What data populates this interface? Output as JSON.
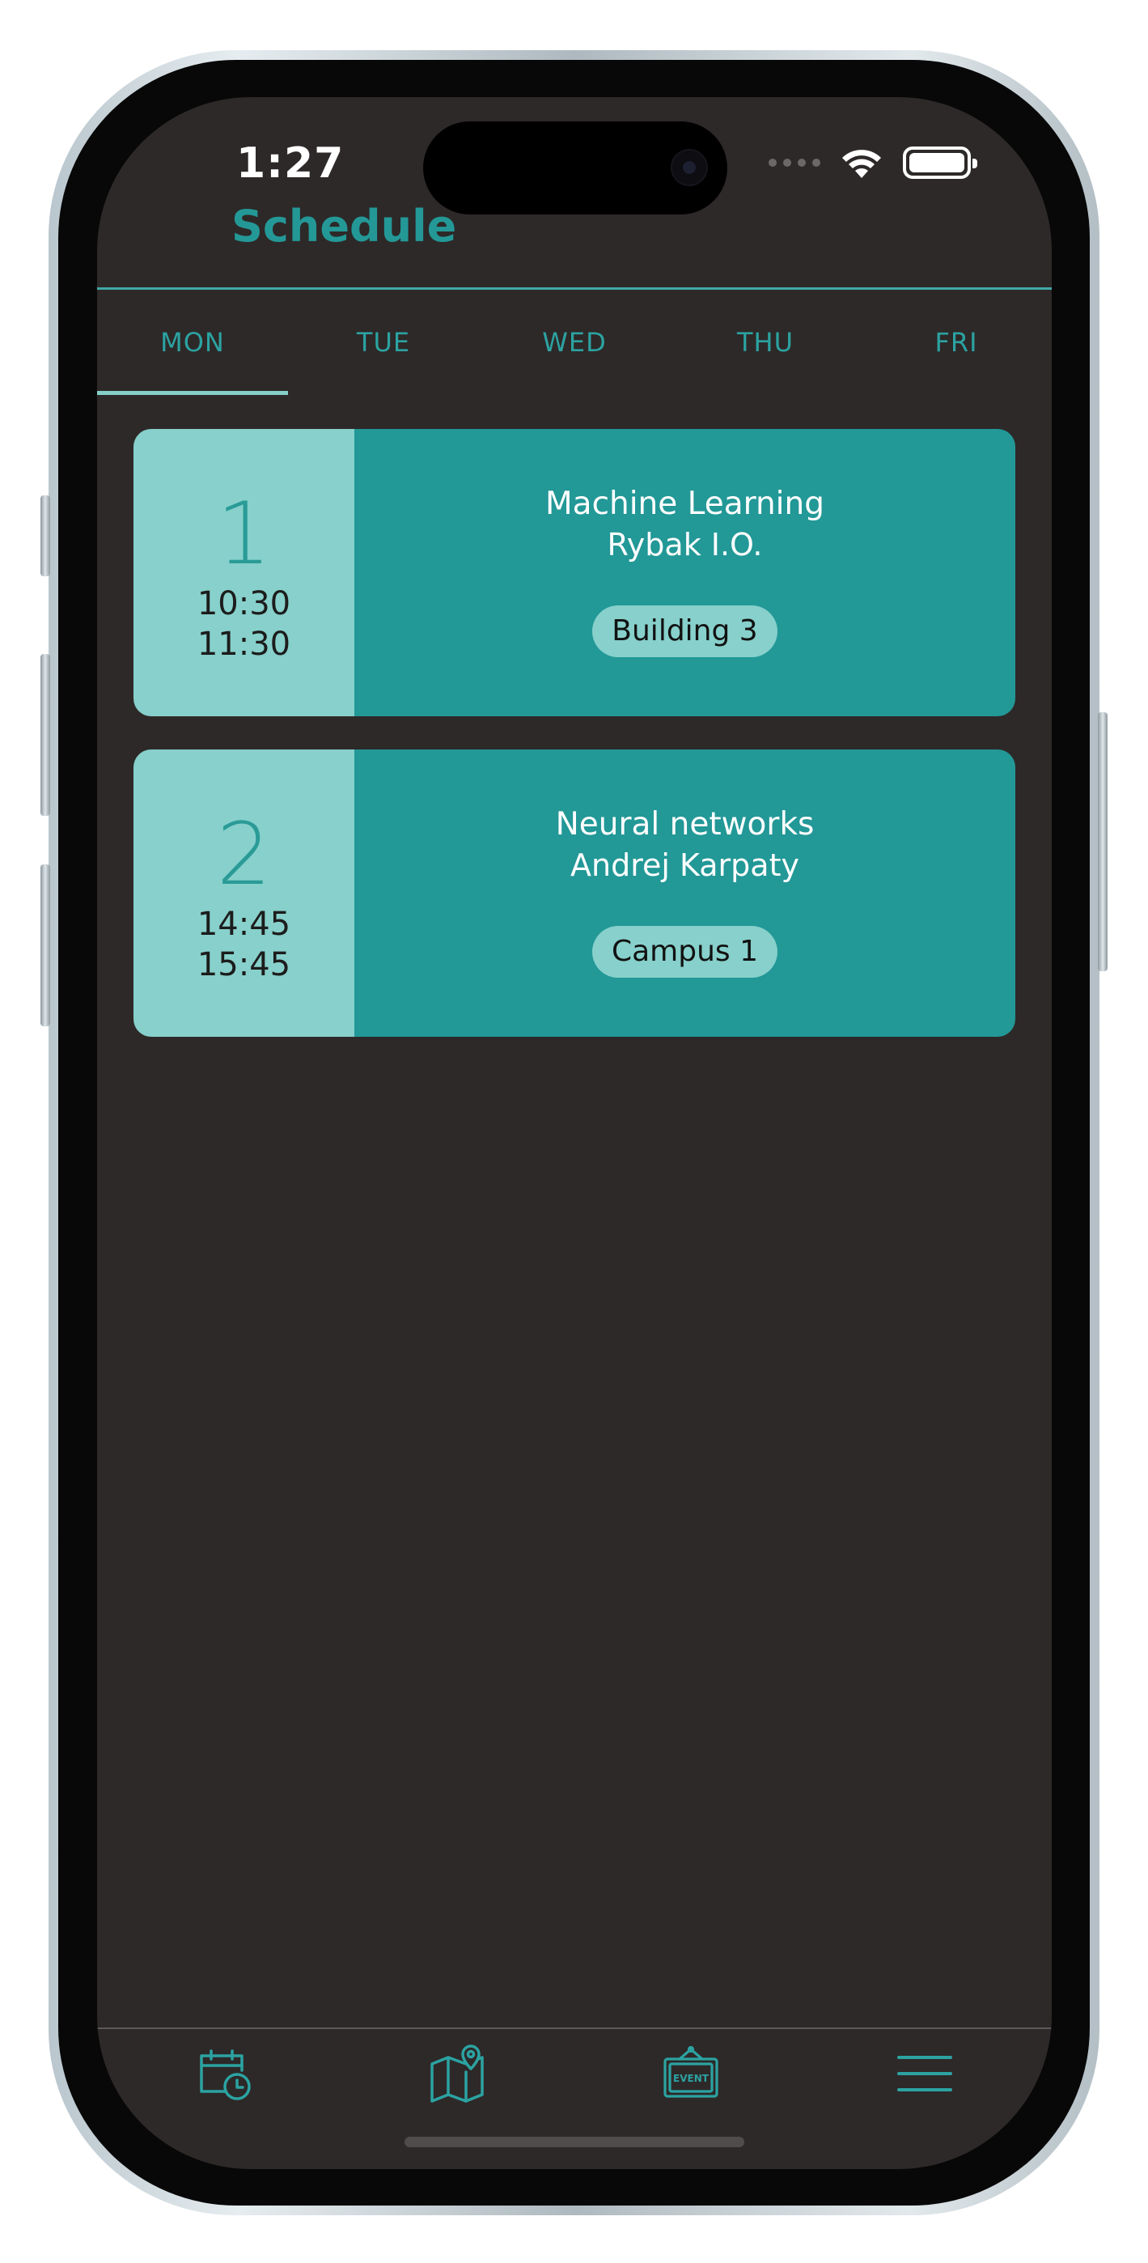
{
  "status_bar": {
    "time": "1:27",
    "icons": [
      "cellular-signal-icon",
      "wifi-icon",
      "battery-icon"
    ]
  },
  "header": {
    "title": "Schedule"
  },
  "tabs": [
    {
      "label": "MON",
      "active": true
    },
    {
      "label": "TUE",
      "active": false
    },
    {
      "label": "WED",
      "active": false
    },
    {
      "label": "THU",
      "active": false
    },
    {
      "label": "FRI",
      "active": false
    }
  ],
  "lessons": [
    {
      "number": "1",
      "start": "10:30",
      "end": "11:30",
      "title": "Machine Learning",
      "teacher": "Rybak I.O.",
      "location": "Building 3"
    },
    {
      "number": "2",
      "start": "14:45",
      "end": "15:45",
      "title": "Neural networks",
      "teacher": "Andrej Karpaty",
      "location": "Campus 1"
    }
  ],
  "tab_bar": {
    "items": [
      {
        "icon": "calendar-clock-icon",
        "badge_text": ""
      },
      {
        "icon": "map-pin-icon",
        "badge_text": ""
      },
      {
        "icon": "event-sign-icon",
        "badge_text": "EVENT"
      },
      {
        "icon": "menu-icon",
        "badge_text": ""
      }
    ]
  },
  "colors": {
    "background": "#2d2928",
    "accent": "#239897",
    "card_light": "#87d0cb",
    "card_dark": "#229897"
  }
}
